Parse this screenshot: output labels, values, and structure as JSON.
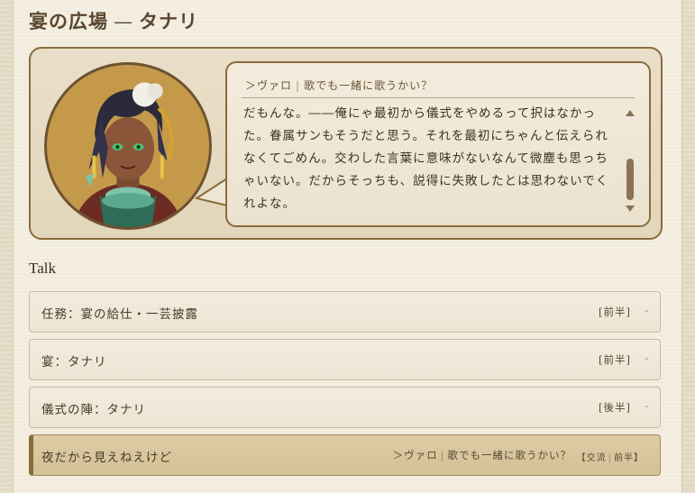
{
  "page": {
    "title_main": "宴の広場",
    "title_sep": "—",
    "title_name": "タナリ"
  },
  "dialogue": {
    "speaker_prefix": "＞ヴァロ",
    "speaker_separator": "|",
    "line_title": "歌でも一緒に歌うかい？",
    "text": "だもんな。――俺にゃ最初から儀式をやめるって択はなかった。眷属サンもそうだと思う。それを最初にちゃんと伝えられなくてごめん。交わした言葉に意味がないなんて微塵も思っちゃいない。だからそっちも、説得に失敗したとは思わないでくれよな。"
  },
  "talk": {
    "heading": "Talk",
    "items": [
      {
        "label": "任務：宴の給仕・一芸披露",
        "tag": "[前半]",
        "dash": "-"
      },
      {
        "label": "宴：タナリ",
        "tag": "[前半]",
        "dash": "-"
      },
      {
        "label": "儀式の陣：タナリ",
        "tag": "[後半]",
        "dash": "-"
      }
    ],
    "active": {
      "label": "夜だから見えねえけど",
      "sub_prefix": "＞ヴァロ",
      "sub_sep": "|",
      "sub_title": "歌でも一緒に歌うかい？",
      "tag_open": "【交流",
      "tag_sep": "|",
      "tag_close": "前半】"
    }
  },
  "icons": {
    "avatar": "character-portrait",
    "scroll_up": "triangle-up-icon",
    "scroll_down": "triangle-down-icon"
  },
  "colors": {
    "accent": "#8a6c3c",
    "background": "#f4efe2",
    "active_row": "#d8c69e"
  }
}
